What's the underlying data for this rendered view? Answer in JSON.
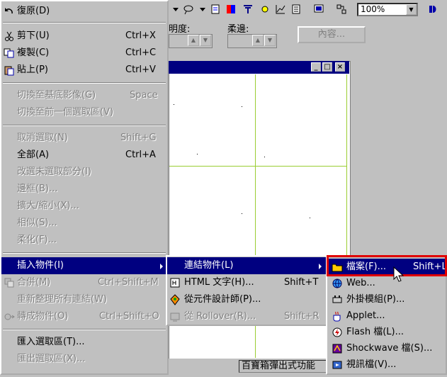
{
  "toolbar": {
    "zoom_value": "100%"
  },
  "props": {
    "label1": "明度:",
    "label2": "柔邊:",
    "content_button": "內容..."
  },
  "status": {
    "text": "百寶箱彈出式功能"
  },
  "edit_menu": {
    "items": [
      {
        "label": "復原(D)",
        "shortcut": "",
        "enabled": true
      },
      {
        "label": "剪下(U)",
        "shortcut": "Ctrl+X",
        "enabled": true
      },
      {
        "label": "複製(C)",
        "shortcut": "Ctrl+C",
        "enabled": true
      },
      {
        "label": "貼上(P)",
        "shortcut": "Ctrl+V",
        "enabled": true
      },
      {
        "label": "切換至基底影像(G)",
        "shortcut": "Space",
        "enabled": false
      },
      {
        "label": "切換至前一個選取區(V)",
        "shortcut": "",
        "enabled": false
      },
      {
        "label": "取消選取(N)",
        "shortcut": "Shift+G",
        "enabled": false
      },
      {
        "label": "全部(A)",
        "shortcut": "Ctrl+A",
        "enabled": true
      },
      {
        "label": "改選未選取部分(I)",
        "shortcut": "",
        "enabled": false
      },
      {
        "label": "邊框(B)...",
        "shortcut": "",
        "enabled": false
      },
      {
        "label": "擴大/縮小(X)...",
        "shortcut": "",
        "enabled": false
      },
      {
        "label": "相似(S)...",
        "shortcut": "",
        "enabled": false
      },
      {
        "label": "柔化(F)...",
        "shortcut": "",
        "enabled": false
      },
      {
        "label": "插入物件(I)",
        "shortcut": "",
        "enabled": true
      },
      {
        "label": "合併(M)",
        "shortcut": "Ctrl+Shift+M",
        "enabled": false
      },
      {
        "label": "重新整理所有連結(W)",
        "shortcut": "",
        "enabled": false
      },
      {
        "label": "轉成物件(O)",
        "shortcut": "Ctrl+Shift+O",
        "enabled": false
      },
      {
        "label": "匯入選取區(T)...",
        "shortcut": "",
        "enabled": true
      },
      {
        "label": "匯出選取區(X)...",
        "shortcut": "",
        "enabled": false
      }
    ]
  },
  "insert_menu": {
    "items": [
      {
        "label": "連結物件(L)",
        "shortcut": "",
        "enabled": true
      },
      {
        "label": "HTML 文字(H)...",
        "shortcut": "Shift+T",
        "enabled": true
      },
      {
        "label": "從元件設計師(P)...",
        "shortcut": "",
        "enabled": true
      },
      {
        "label": "從 Rollover(R)...",
        "shortcut": "Shift+R",
        "enabled": false
      }
    ]
  },
  "link_menu": {
    "items": [
      {
        "label": "檔案(F)...",
        "shortcut": "Shift+L"
      },
      {
        "label": "Web...",
        "shortcut": ""
      },
      {
        "label": "外掛模組(P)...",
        "shortcut": ""
      },
      {
        "label": "Applet...",
        "shortcut": ""
      },
      {
        "label": "Flash 檔(L)...",
        "shortcut": ""
      },
      {
        "label": "Shockwave 檔(S)...",
        "shortcut": ""
      },
      {
        "label": "視訊檔(V)...",
        "shortcut": ""
      }
    ]
  },
  "colors": {
    "menu_bg": "#c0c0c0",
    "selection": "#000080",
    "highlight_box": "#e00000",
    "guide": "#9acd32"
  }
}
